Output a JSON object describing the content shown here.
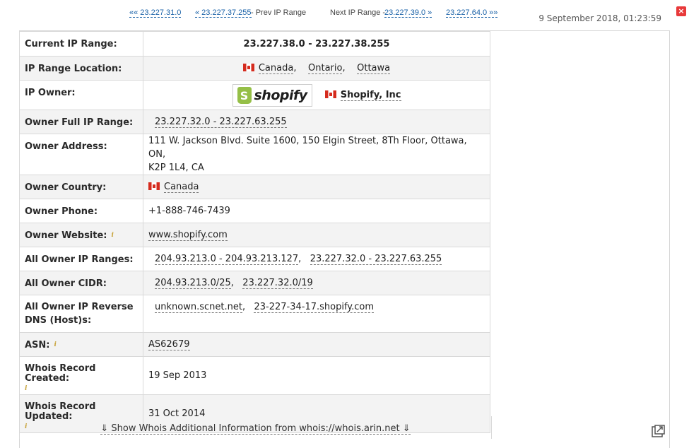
{
  "nav": {
    "first": "«« 23.227.31.0",
    "prev_link": "« 23.227.37.255",
    "prev_text": " - Prev IP Range",
    "next_text": "Next IP Range - ",
    "next_link": "23.227.39.0 »",
    "last": "23.227.64.0 »»"
  },
  "datetime": "9 September 2018, 01:23:59",
  "rows": {
    "current_range": {
      "label": "Current IP Range:",
      "value": "23.227.38.0 - 23.227.38.255"
    },
    "location": {
      "label": "IP Range Location:",
      "country": "Canada",
      "region": "Ontario",
      "city": "Ottawa"
    },
    "owner": {
      "label": "IP Owner:",
      "logo_text": "shopify",
      "name": "Shopify, Inc"
    },
    "full_range": {
      "label": "Owner Full IP Range:",
      "value": "23.227.32.0 - 23.227.63.255"
    },
    "address": {
      "label": "Owner Address:",
      "line1": "111 W. Jackson Blvd. Suite 1600, 150 Elgin Street, 8Th Floor, Ottawa, ON,",
      "line2": "K2P 1L4, CA"
    },
    "country": {
      "label": "Owner Country:",
      "value": "Canada"
    },
    "phone": {
      "label": "Owner Phone:",
      "value": "+1-888-746-7439"
    },
    "website": {
      "label": "Owner Website:",
      "value": "www.shopify.com"
    },
    "all_ranges": {
      "label": "All Owner IP Ranges:",
      "r1": "204.93.213.0 - 204.93.213.127",
      "r2": "23.227.32.0 - 23.227.63.255"
    },
    "cidr": {
      "label": "All Owner CIDR:",
      "c1": "204.93.213.0/25",
      "c2": "23.227.32.0/19"
    },
    "rdns": {
      "label_line1": "All Owner IP Reverse",
      "label_line2": "DNS (Host)s:",
      "h1": "unknown.scnet.net",
      "h2": "23-227-34-17.shopify.com"
    },
    "asn": {
      "label": "ASN:",
      "value": "AS62679"
    },
    "created": {
      "label": "Whois Record Created:",
      "value": "19 Sep 2013"
    },
    "updated": {
      "label": "Whois Record Updated:",
      "value": "31 Oct 2014"
    }
  },
  "show_more": "⇓ Show Whois Additional Information from whois://whois.arin.net ⇓",
  "icons": {
    "info": "i",
    "close": "×",
    "logo_bag": "S"
  },
  "colors": {
    "link": "#1a62a8",
    "flag_red": "#d52b1e",
    "shopify_green": "#95bf47",
    "close_red": "#e8393a"
  }
}
